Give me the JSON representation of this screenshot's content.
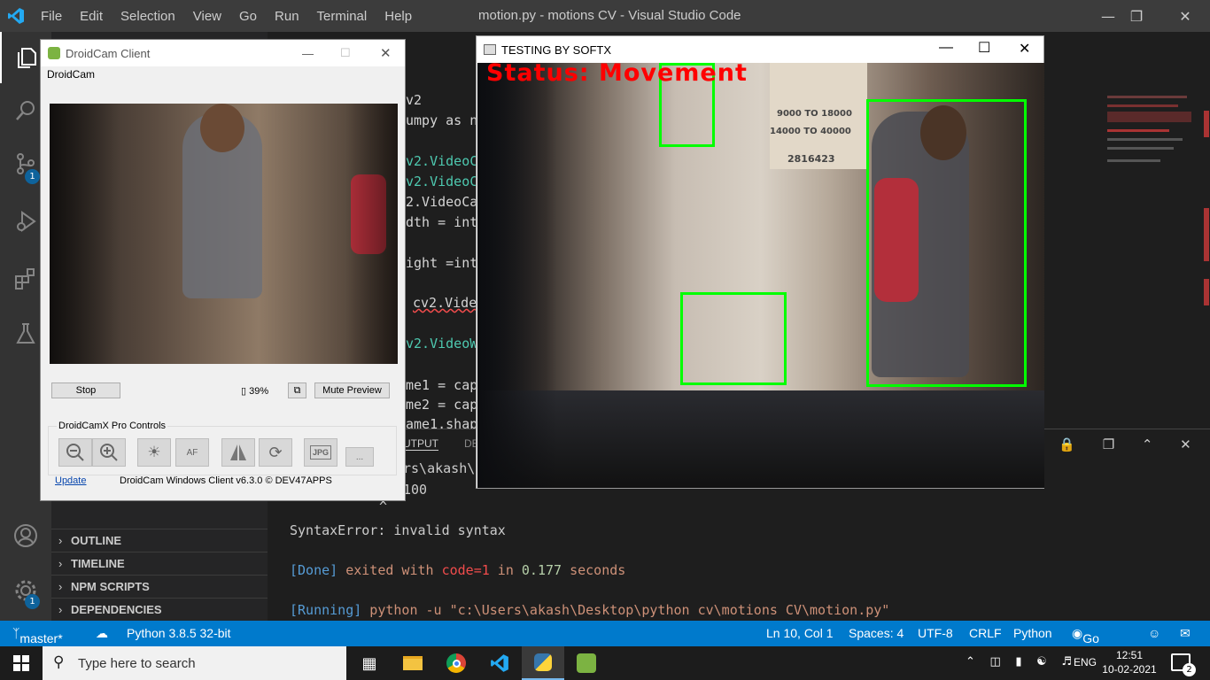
{
  "vscode": {
    "menu": [
      "File",
      "Edit",
      "Selection",
      "View",
      "Go",
      "Run",
      "Terminal",
      "Help"
    ],
    "window_title": "motion.py - motions CV - Visual Studio Code",
    "activity_badges": {
      "source_control": "1",
      "settings": "1"
    },
    "sidebar_sections": [
      "OUTLINE",
      "TIMELINE",
      "NPM SCRIPTS",
      "DEPENDENCIES"
    ],
    "code_fragments": [
      "v2",
      "umpy as n",
      "v2.VideoC",
      "v2.VideoC",
      "2.VideoCa",
      "dth = int",
      "ight =int",
      "cv2.Vide",
      "v2.VideoW",
      "me1 = cap",
      "me2 = cap",
      "ame1.shap"
    ],
    "panel_tabs": [
      "UTPUT",
      "DE"
    ],
    "terminal": {
      "line1": "rs\\akash\\",
      "line2": "100",
      "caret": "^",
      "error": "SyntaxError: invalid syntax",
      "done_tag": "[Done]",
      "done_text": " exited with ",
      "done_code": "code=1",
      "done_in": " in ",
      "done_time": "0.177",
      "done_seconds": " seconds",
      "running_tag": "[Running]",
      "running_cmd": " python -u \"c:\\Users\\akash\\Desktop\\python cv\\motions CV\\motion.py\""
    },
    "statusbar": {
      "branch": "master*",
      "python": "Python 3.8.5 32-bit",
      "position": "Ln 10, Col 1",
      "spaces": "Spaces: 4",
      "encoding": "UTF-8",
      "eol": "CRLF",
      "language": "Python",
      "golive": "Go Live"
    }
  },
  "droidcam": {
    "title": "DroidCam Client",
    "menu": "DroidCam",
    "stop_label": "Stop",
    "battery": "39%",
    "mute_label": "Mute Preview",
    "pro_controls_label": "DroidCamX Pro Controls",
    "af_label": "AF",
    "more_label": "...",
    "jpg_label": "JPG",
    "update_link": "Update",
    "version": "DroidCam Windows Client v6.3.0 © DEV47APPS"
  },
  "opencv_window": {
    "title": "TESTING BY SOFTX",
    "status_text": "Status: Movement",
    "status_color": "#ff0000",
    "box_color": "#00ff00",
    "sign_lines": [
      "9000 TO 18000",
      "14000 TO 40000",
      "2816423"
    ]
  },
  "taskbar": {
    "search_placeholder": "Type here to search",
    "language": "ENG",
    "time": "12:51",
    "date": "10-02-2021",
    "notification_count": "2"
  },
  "colors": {
    "accent": "#007acc",
    "activity_bar": "#333333",
    "sidebar": "#252526",
    "editor": "#1e1e1e"
  }
}
